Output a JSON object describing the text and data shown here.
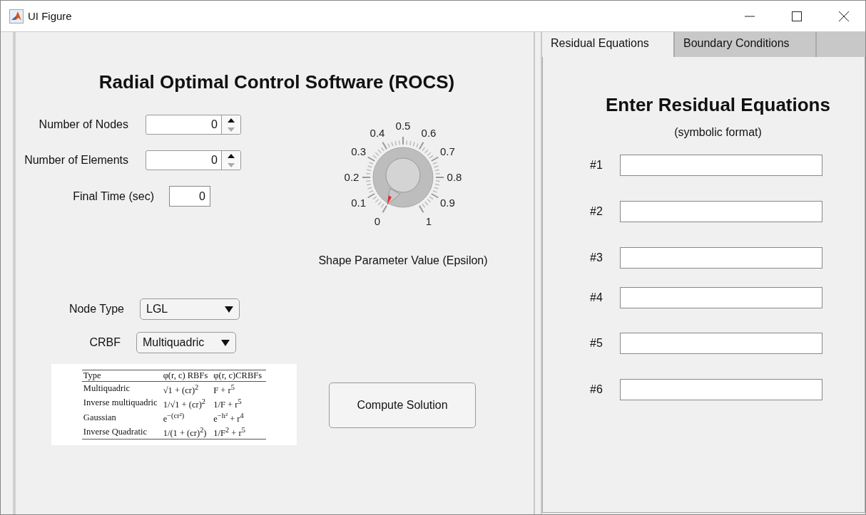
{
  "window": {
    "title": "UI Figure"
  },
  "app_title": "Radial Optimal Control Software (ROCS)",
  "spinners": [
    {
      "label": "Number of Nodes",
      "value": "0"
    },
    {
      "label": "Number of Elements",
      "value": "0"
    }
  ],
  "final_time": {
    "label": "Final Time (sec)",
    "value": "0"
  },
  "knob": {
    "ticks": [
      "0",
      "0.1",
      "0.2",
      "0.3",
      "0.4",
      "0.5",
      "0.6",
      "0.7",
      "0.8",
      "0.9",
      "1"
    ],
    "level": 0,
    "label": "Shape Parameter Value (Epsilon)"
  },
  "dropdowns": [
    {
      "label": "Node Type",
      "value": "LGL"
    },
    {
      "label": "CRBF",
      "value": "Multiquadric"
    }
  ],
  "rbf_table": {
    "columns": [
      "Type",
      "φ(r, c) RBFs",
      "φ(r, c)CRBFs"
    ],
    "rows": [
      [
        "Multiquadric",
        "√1 + (cr)$^{2}$",
        "F + r$^{5}$"
      ],
      [
        "Inverse multiquadric",
        "1/√1 + (cr)$^{2}$",
        "1/F + r$^{5}$"
      ],
      [
        "Gaussian",
        "e$^{−(cr²)}$",
        "e$^{−h²}$ + r$^{4}$"
      ],
      [
        "Inverse Quadratic",
        "1/(1 + (cr)$^{2}$)",
        "1/F$^{2}$ + r$^{5}$"
      ]
    ]
  },
  "compute_button": "Compute Solution",
  "tabs": [
    {
      "label": "Residual Equations",
      "selected": true
    },
    {
      "label": "Boundary Conditions",
      "selected": false
    }
  ],
  "residual": {
    "title": "Enter Residual Equations",
    "subtitle": "(symbolic format)",
    "fields": [
      "#1",
      "#2",
      "#3",
      "#4",
      "#5",
      "#6"
    ]
  }
}
